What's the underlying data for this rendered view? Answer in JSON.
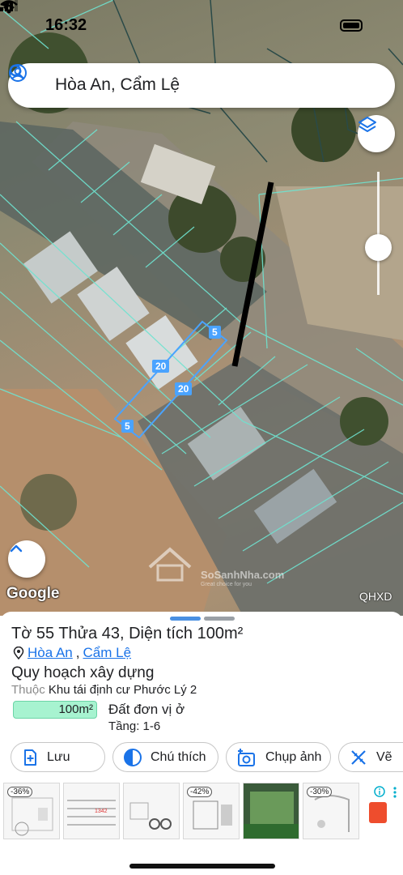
{
  "status_bar": {
    "time": "16:32"
  },
  "search": {
    "query": "Hòa An, Cẩm Lệ"
  },
  "map": {
    "attribution": "Google",
    "layer_label": "QHXD",
    "parcel_dimensions": [
      "5",
      "20",
      "20",
      "5"
    ],
    "watermark": {
      "brand": "SoSanhNha.com",
      "tagline": "Great choice for you"
    }
  },
  "sheet": {
    "title": "Tờ 55 Thửa 43, Diện tích 100m²",
    "location": {
      "ward": "Hòa An",
      "separator": ",",
      "district": "Cẩm Lệ"
    },
    "planning_title": "Quy hoạch xây dựng",
    "belongs_label": "Thuộc",
    "belongs_value": "Khu tái định cư Phước Lý 2",
    "zone_area": "100m²",
    "zone_name": "Đất đơn vị ở",
    "floors": "Tầng: 1-6",
    "actions": [
      {
        "label": "Lưu",
        "icon": "add-bookmark-icon"
      },
      {
        "label": "Chú thích",
        "icon": "half-circle-icon"
      },
      {
        "label": "Chụp ảnh",
        "icon": "add-photo-icon"
      },
      {
        "label": "Vẽ",
        "icon": "draw-ruler-icon"
      }
    ]
  },
  "ad_strip": {
    "items": [
      {
        "discount": "-36%"
      },
      {
        "discount": ""
      },
      {
        "discount": ""
      },
      {
        "discount": "-42%"
      },
      {
        "discount": ""
      },
      {
        "discount": "-30%"
      }
    ]
  },
  "colors": {
    "accent": "#1a73e8",
    "zone": "#a7f3d0",
    "parcel": "#4aa3ff",
    "boundary": "#6fe3d0"
  }
}
